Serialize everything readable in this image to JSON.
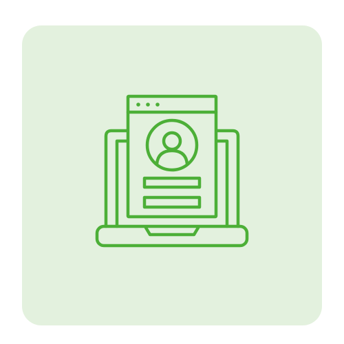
{
  "icon": {
    "name": "laptop-user-profile-icon",
    "stroke_color": "#4caf37",
    "background_color": "#e3f1de"
  }
}
